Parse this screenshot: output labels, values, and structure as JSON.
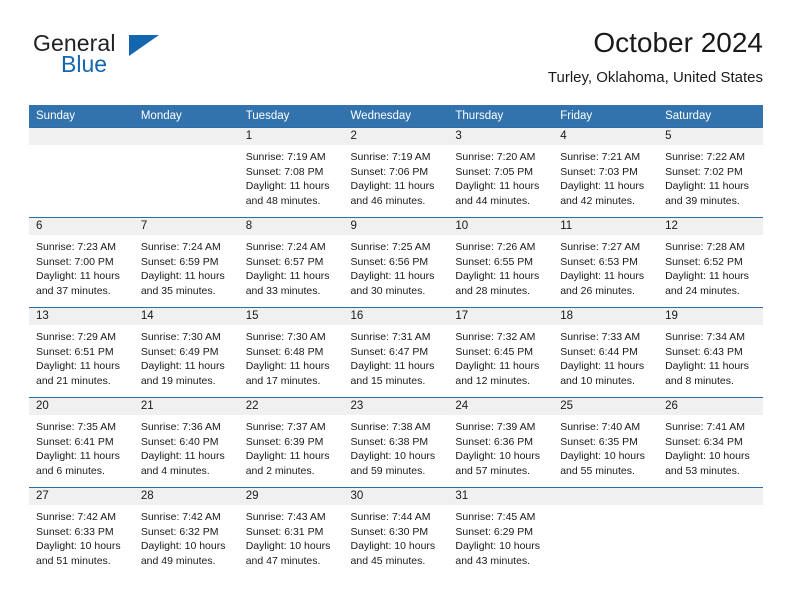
{
  "brand": {
    "name_part1": "General",
    "name_part2": "Blue",
    "accent_color": "#1566b0"
  },
  "header": {
    "title": "October 2024",
    "subtitle": "Turley, Oklahoma, United States"
  },
  "calendar": {
    "header_bg": "#3273ae",
    "daynum_bg": "#f0f0f0",
    "weekday_headers": [
      "Sunday",
      "Monday",
      "Tuesday",
      "Wednesday",
      "Thursday",
      "Friday",
      "Saturday"
    ],
    "weeks": [
      [
        {
          "day": "",
          "lines": []
        },
        {
          "day": "",
          "lines": []
        },
        {
          "day": "1",
          "lines": [
            "Sunrise: 7:19 AM",
            "Sunset: 7:08 PM",
            "Daylight: 11 hours",
            "and 48 minutes."
          ]
        },
        {
          "day": "2",
          "lines": [
            "Sunrise: 7:19 AM",
            "Sunset: 7:06 PM",
            "Daylight: 11 hours",
            "and 46 minutes."
          ]
        },
        {
          "day": "3",
          "lines": [
            "Sunrise: 7:20 AM",
            "Sunset: 7:05 PM",
            "Daylight: 11 hours",
            "and 44 minutes."
          ]
        },
        {
          "day": "4",
          "lines": [
            "Sunrise: 7:21 AM",
            "Sunset: 7:03 PM",
            "Daylight: 11 hours",
            "and 42 minutes."
          ]
        },
        {
          "day": "5",
          "lines": [
            "Sunrise: 7:22 AM",
            "Sunset: 7:02 PM",
            "Daylight: 11 hours",
            "and 39 minutes."
          ]
        }
      ],
      [
        {
          "day": "6",
          "lines": [
            "Sunrise: 7:23 AM",
            "Sunset: 7:00 PM",
            "Daylight: 11 hours",
            "and 37 minutes."
          ]
        },
        {
          "day": "7",
          "lines": [
            "Sunrise: 7:24 AM",
            "Sunset: 6:59 PM",
            "Daylight: 11 hours",
            "and 35 minutes."
          ]
        },
        {
          "day": "8",
          "lines": [
            "Sunrise: 7:24 AM",
            "Sunset: 6:57 PM",
            "Daylight: 11 hours",
            "and 33 minutes."
          ]
        },
        {
          "day": "9",
          "lines": [
            "Sunrise: 7:25 AM",
            "Sunset: 6:56 PM",
            "Daylight: 11 hours",
            "and 30 minutes."
          ]
        },
        {
          "day": "10",
          "lines": [
            "Sunrise: 7:26 AM",
            "Sunset: 6:55 PM",
            "Daylight: 11 hours",
            "and 28 minutes."
          ]
        },
        {
          "day": "11",
          "lines": [
            "Sunrise: 7:27 AM",
            "Sunset: 6:53 PM",
            "Daylight: 11 hours",
            "and 26 minutes."
          ]
        },
        {
          "day": "12",
          "lines": [
            "Sunrise: 7:28 AM",
            "Sunset: 6:52 PM",
            "Daylight: 11 hours",
            "and 24 minutes."
          ]
        }
      ],
      [
        {
          "day": "13",
          "lines": [
            "Sunrise: 7:29 AM",
            "Sunset: 6:51 PM",
            "Daylight: 11 hours",
            "and 21 minutes."
          ]
        },
        {
          "day": "14",
          "lines": [
            "Sunrise: 7:30 AM",
            "Sunset: 6:49 PM",
            "Daylight: 11 hours",
            "and 19 minutes."
          ]
        },
        {
          "day": "15",
          "lines": [
            "Sunrise: 7:30 AM",
            "Sunset: 6:48 PM",
            "Daylight: 11 hours",
            "and 17 minutes."
          ]
        },
        {
          "day": "16",
          "lines": [
            "Sunrise: 7:31 AM",
            "Sunset: 6:47 PM",
            "Daylight: 11 hours",
            "and 15 minutes."
          ]
        },
        {
          "day": "17",
          "lines": [
            "Sunrise: 7:32 AM",
            "Sunset: 6:45 PM",
            "Daylight: 11 hours",
            "and 12 minutes."
          ]
        },
        {
          "day": "18",
          "lines": [
            "Sunrise: 7:33 AM",
            "Sunset: 6:44 PM",
            "Daylight: 11 hours",
            "and 10 minutes."
          ]
        },
        {
          "day": "19",
          "lines": [
            "Sunrise: 7:34 AM",
            "Sunset: 6:43 PM",
            "Daylight: 11 hours",
            "and 8 minutes."
          ]
        }
      ],
      [
        {
          "day": "20",
          "lines": [
            "Sunrise: 7:35 AM",
            "Sunset: 6:41 PM",
            "Daylight: 11 hours",
            "and 6 minutes."
          ]
        },
        {
          "day": "21",
          "lines": [
            "Sunrise: 7:36 AM",
            "Sunset: 6:40 PM",
            "Daylight: 11 hours",
            "and 4 minutes."
          ]
        },
        {
          "day": "22",
          "lines": [
            "Sunrise: 7:37 AM",
            "Sunset: 6:39 PM",
            "Daylight: 11 hours",
            "and 2 minutes."
          ]
        },
        {
          "day": "23",
          "lines": [
            "Sunrise: 7:38 AM",
            "Sunset: 6:38 PM",
            "Daylight: 10 hours",
            "and 59 minutes."
          ]
        },
        {
          "day": "24",
          "lines": [
            "Sunrise: 7:39 AM",
            "Sunset: 6:36 PM",
            "Daylight: 10 hours",
            "and 57 minutes."
          ]
        },
        {
          "day": "25",
          "lines": [
            "Sunrise: 7:40 AM",
            "Sunset: 6:35 PM",
            "Daylight: 10 hours",
            "and 55 minutes."
          ]
        },
        {
          "day": "26",
          "lines": [
            "Sunrise: 7:41 AM",
            "Sunset: 6:34 PM",
            "Daylight: 10 hours",
            "and 53 minutes."
          ]
        }
      ],
      [
        {
          "day": "27",
          "lines": [
            "Sunrise: 7:42 AM",
            "Sunset: 6:33 PM",
            "Daylight: 10 hours",
            "and 51 minutes."
          ]
        },
        {
          "day": "28",
          "lines": [
            "Sunrise: 7:42 AM",
            "Sunset: 6:32 PM",
            "Daylight: 10 hours",
            "and 49 minutes."
          ]
        },
        {
          "day": "29",
          "lines": [
            "Sunrise: 7:43 AM",
            "Sunset: 6:31 PM",
            "Daylight: 10 hours",
            "and 47 minutes."
          ]
        },
        {
          "day": "30",
          "lines": [
            "Sunrise: 7:44 AM",
            "Sunset: 6:30 PM",
            "Daylight: 10 hours",
            "and 45 minutes."
          ]
        },
        {
          "day": "31",
          "lines": [
            "Sunrise: 7:45 AM",
            "Sunset: 6:29 PM",
            "Daylight: 10 hours",
            "and 43 minutes."
          ]
        },
        {
          "day": "",
          "lines": []
        },
        {
          "day": "",
          "lines": []
        }
      ]
    ]
  }
}
